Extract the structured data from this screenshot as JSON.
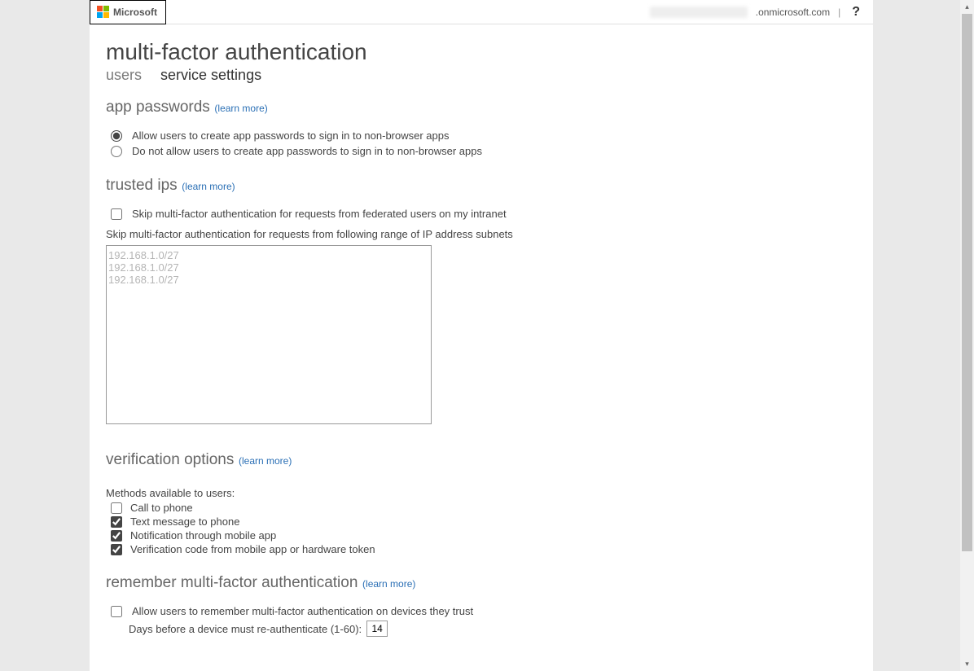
{
  "header": {
    "brand": "Microsoft",
    "account_suffix": ".onmicrosoft.com",
    "divider": "|",
    "help": "?"
  },
  "page": {
    "title": "multi-factor authentication",
    "tabs": {
      "users": "users",
      "service_settings": "service settings"
    }
  },
  "app_passwords": {
    "heading": "app passwords",
    "learn_more": "(learn more)",
    "allow": "Allow users to create app passwords to sign in to non-browser apps",
    "deny": "Do not allow users to create app passwords to sign in to non-browser apps"
  },
  "trusted_ips": {
    "heading": "trusted ips",
    "learn_more": "(learn more)",
    "skip_federated": "Skip multi-factor authentication for requests from federated users on my intranet",
    "skip_range_label": "Skip multi-factor authentication for requests from following range of IP address subnets",
    "placeholder": "192.168.1.0/27\n192.168.1.0/27\n192.168.1.0/27"
  },
  "verification": {
    "heading": "verification options",
    "learn_more": "(learn more)",
    "methods_label": "Methods available to users:",
    "call": "Call to phone",
    "text": "Text message to phone",
    "notify": "Notification through mobile app",
    "code": "Verification code from mobile app or hardware token"
  },
  "remember": {
    "heading": "remember multi-factor authentication",
    "learn_more": "(learn more)",
    "allow": "Allow users to remember multi-factor authentication on devices they trust",
    "days_label": "Days before a device must re-authenticate (1-60):",
    "days_value": "14"
  }
}
